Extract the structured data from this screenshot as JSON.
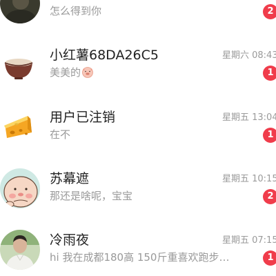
{
  "conversations": [
    {
      "name": "",
      "preview": "怎么得到你",
      "time": "",
      "unread": "2",
      "avatar_icon": "dark-photo-avatar"
    },
    {
      "name": "小红薯68DA26C5",
      "preview": "美美的",
      "preview_emoji": "pig-face-emoji",
      "time": "星期六 08:43",
      "unread": "1",
      "avatar_icon": "bowl-icon"
    },
    {
      "name": "用户已注销",
      "preview": "在不",
      "time": "星期五 13:04",
      "unread": "1",
      "avatar_icon": "cheese-icon"
    },
    {
      "name": "苏幕遮",
      "preview": "那还是啥呢，宝宝",
      "time": "星期五 10:15",
      "unread": "2",
      "avatar_icon": "cartoon-character-avatar"
    },
    {
      "name": "冷雨夜",
      "preview": "hi 我在成都180高 150斤重喜欢跑步…",
      "time": "星期五 07:15",
      "unread": "1",
      "avatar_icon": "person-photo-avatar"
    }
  ],
  "colors": {
    "badge": "#f03c4b",
    "title": "#222222",
    "secondary": "#999999"
  }
}
